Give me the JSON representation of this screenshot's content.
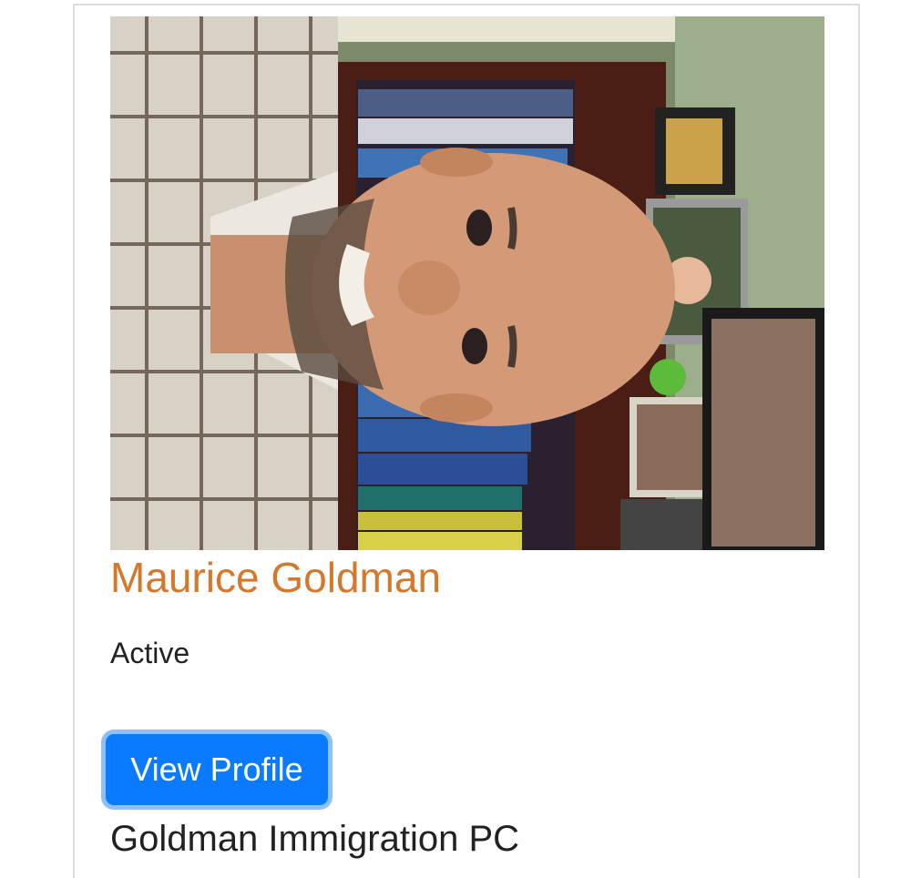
{
  "profile": {
    "name": "Maurice Goldman",
    "status": "Active",
    "view_profile_label": "View Profile",
    "company": "Goldman Immigration PC"
  },
  "colors": {
    "name_accent": "#d6782c",
    "button_bg": "#0a7bff",
    "button_focus_ring": "#8cc0ff"
  },
  "photo": {
    "description_icon": "profile-photo"
  }
}
